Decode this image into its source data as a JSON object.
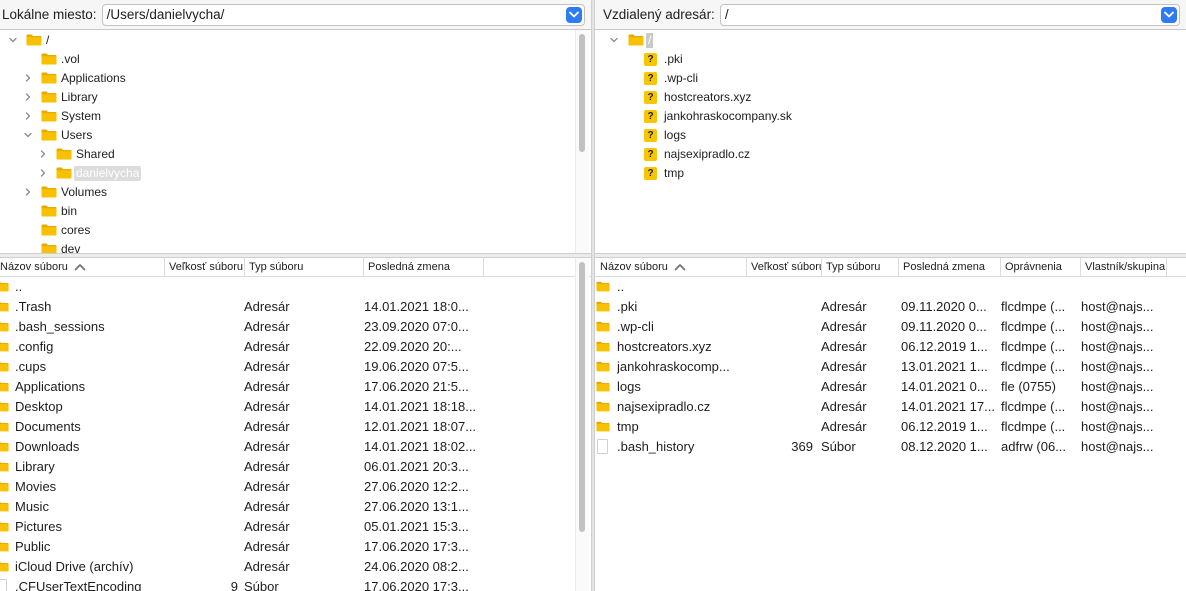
{
  "left": {
    "path_label": "Lokálne miesto:",
    "path_value": "/Users/danielvycha/",
    "tree": [
      {
        "label": "/",
        "icon": "folder-icon",
        "expanded": true
      },
      {
        "label": ".vol",
        "icon": "folder-icon"
      },
      {
        "label": "Applications",
        "icon": "folder-icon",
        "collapsed": true
      },
      {
        "label": "Library",
        "icon": "folder-icon",
        "collapsed": true
      },
      {
        "label": "System",
        "icon": "folder-icon",
        "collapsed": true
      },
      {
        "label": "Users",
        "icon": "folder-icon",
        "expanded": true
      },
      {
        "label": "Shared",
        "icon": "folder-icon",
        "collapsed": true
      },
      {
        "label": "danielvycha",
        "icon": "folder-icon",
        "collapsed": true,
        "selected": true
      },
      {
        "label": "Volumes",
        "icon": "folder-icon",
        "collapsed": true
      },
      {
        "label": "bin",
        "icon": "folder-icon"
      },
      {
        "label": "cores",
        "icon": "folder-icon"
      },
      {
        "label": "dev",
        "icon": "folder-icon"
      }
    ],
    "columns": [
      "Názov súboru",
      "Veľkosť súboru",
      "Typ súboru",
      "Posledná zmena"
    ],
    "rows": [
      {
        "name": "..",
        "size": "",
        "type": "",
        "modified": "",
        "icon": "folder-icon"
      },
      {
        "name": ".Trash",
        "size": "",
        "type": "Adresár",
        "modified": "14.01.2021 18:0...",
        "icon": "folder-icon"
      },
      {
        "name": ".bash_sessions",
        "size": "",
        "type": "Adresár",
        "modified": "23.09.2020 07:0...",
        "icon": "folder-icon"
      },
      {
        "name": ".config",
        "size": "",
        "type": "Adresár",
        "modified": "22.09.2020 20:...",
        "icon": "folder-icon"
      },
      {
        "name": ".cups",
        "size": "",
        "type": "Adresár",
        "modified": "19.06.2020 07:5...",
        "icon": "folder-icon"
      },
      {
        "name": "Applications",
        "size": "",
        "type": "Adresár",
        "modified": "17.06.2020 21:5...",
        "icon": "folder-icon"
      },
      {
        "name": "Desktop",
        "size": "",
        "type": "Adresár",
        "modified": "14.01.2021 18:18...",
        "icon": "folder-icon"
      },
      {
        "name": "Documents",
        "size": "",
        "type": "Adresár",
        "modified": "12.01.2021 18:07...",
        "icon": "folder-icon"
      },
      {
        "name": "Downloads",
        "size": "",
        "type": "Adresár",
        "modified": "14.01.2021 18:02...",
        "icon": "folder-icon"
      },
      {
        "name": "Library",
        "size": "",
        "type": "Adresár",
        "modified": "06.01.2021 20:3...",
        "icon": "folder-icon"
      },
      {
        "name": "Movies",
        "size": "",
        "type": "Adresár",
        "modified": "27.06.2020 12:2...",
        "icon": "folder-icon"
      },
      {
        "name": "Music",
        "size": "",
        "type": "Adresár",
        "modified": "27.06.2020 13:1...",
        "icon": "folder-icon"
      },
      {
        "name": "Pictures",
        "size": "",
        "type": "Adresár",
        "modified": "05.01.2021 15:3...",
        "icon": "folder-icon"
      },
      {
        "name": "Public",
        "size": "",
        "type": "Adresár",
        "modified": "17.06.2020 17:3...",
        "icon": "folder-icon"
      },
      {
        "name": "iCloud Drive (archív)",
        "size": "",
        "type": "Adresár",
        "modified": "24.06.2020 08:2...",
        "icon": "folder-icon"
      },
      {
        "name": ".CFUserTextEncoding",
        "size": "9",
        "type": "Súbor",
        "modified": "17.06.2020 17:3...",
        "icon": "file-icon"
      }
    ]
  },
  "right": {
    "path_label": "Vzdialený adresár:",
    "path_value": "/",
    "tree": [
      {
        "label": "/",
        "icon": "folder-icon",
        "expanded": true,
        "selected": true
      },
      {
        "label": ".pki",
        "icon": "unknown-icon"
      },
      {
        "label": ".wp-cli",
        "icon": "unknown-icon"
      },
      {
        "label": "hostcreators.xyz",
        "icon": "unknown-icon"
      },
      {
        "label": "jankohraskocompany.sk",
        "icon": "unknown-icon"
      },
      {
        "label": "logs",
        "icon": "unknown-icon"
      },
      {
        "label": "najsexipradlo.cz",
        "icon": "unknown-icon"
      },
      {
        "label": "tmp",
        "icon": "unknown-icon"
      }
    ],
    "columns": [
      "Názov súboru",
      "Veľkosť súboru",
      "Typ súboru",
      "Posledná zmena",
      "Oprávnenia",
      "Vlastník/skupina"
    ],
    "rows": [
      {
        "name": "..",
        "size": "",
        "type": "",
        "modified": "",
        "perms": "",
        "owner": "",
        "icon": "folder-icon"
      },
      {
        "name": ".pki",
        "size": "",
        "type": "Adresár",
        "modified": "09.11.2020 0...",
        "perms": "flcdmpe (...",
        "owner": "host@najs...",
        "icon": "folder-icon"
      },
      {
        "name": ".wp-cli",
        "size": "",
        "type": "Adresár",
        "modified": "09.11.2020 0...",
        "perms": "flcdmpe (...",
        "owner": "host@najs...",
        "icon": "folder-icon"
      },
      {
        "name": "hostcreators.xyz",
        "size": "",
        "type": "Adresár",
        "modified": "06.12.2019 1...",
        "perms": "flcdmpe (...",
        "owner": "host@najs...",
        "icon": "folder-icon"
      },
      {
        "name": "jankohraskocomp...",
        "size": "",
        "type": "Adresár",
        "modified": "13.01.2021 1...",
        "perms": "flcdmpe (...",
        "owner": "host@najs...",
        "icon": "folder-icon"
      },
      {
        "name": "logs",
        "size": "",
        "type": "Adresár",
        "modified": "14.01.2021 0...",
        "perms": "fle (0755)",
        "owner": "host@najs...",
        "icon": "folder-icon"
      },
      {
        "name": "najsexipradlo.cz",
        "size": "",
        "type": "Adresár",
        "modified": "14.01.2021 17...",
        "perms": "flcdmpe (...",
        "owner": "host@najs...",
        "icon": "folder-icon"
      },
      {
        "name": "tmp",
        "size": "",
        "type": "Adresár",
        "modified": "06.12.2019 1...",
        "perms": "flcdmpe (...",
        "owner": "host@najs...",
        "icon": "folder-icon"
      },
      {
        "name": ".bash_history",
        "size": "369",
        "type": "Súbor",
        "modified": "08.12.2020 1...",
        "perms": "adfrw (06...",
        "owner": "host@najs...",
        "icon": "file-icon"
      }
    ]
  },
  "colors": {
    "folder": "#f7c100",
    "folder_tab": "#e8a900",
    "unknown": "#f7c600",
    "accent": "#2f7bf6"
  }
}
